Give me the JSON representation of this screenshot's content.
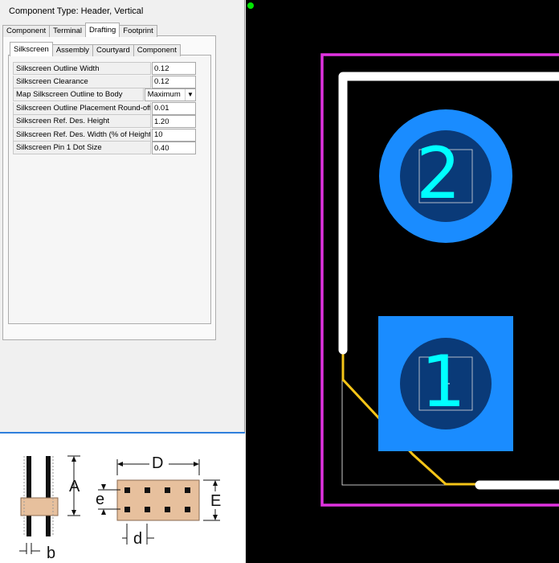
{
  "component_type": "Component Type: Header, Vertical",
  "main_tabs": [
    {
      "label": "Component",
      "active": false
    },
    {
      "label": "Terminal",
      "active": false
    },
    {
      "label": "Drafting",
      "active": true
    },
    {
      "label": "Footprint",
      "active": false
    }
  ],
  "sub_tabs": [
    {
      "label": "Silkscreen",
      "active": true
    },
    {
      "label": "Assembly",
      "active": false
    },
    {
      "label": "Courtyard",
      "active": false
    },
    {
      "label": "Component",
      "active": false
    }
  ],
  "properties": [
    {
      "label": "Silkscreen Outline Width",
      "value": "0.12"
    },
    {
      "label": "Silkscreen Clearance",
      "value": "0.12"
    },
    {
      "label": "Map Silkscreen Outline to Body",
      "value": "Maximum"
    },
    {
      "label": "Silkscreen Outline Placement Round-off",
      "value": "0.01"
    },
    {
      "label": "Silkscreen Ref. Des. Height",
      "value": "1.20"
    },
    {
      "label": "Silkscreen Ref. Des. Width (% of Height)",
      "value": "10"
    },
    {
      "label": "Silkscreen Pin 1 Dot Size",
      "value": "0.40"
    }
  ],
  "diagram_labels": {
    "A": "A",
    "b": "b",
    "D": "D",
    "e": "e",
    "E": "E",
    "d": "d"
  },
  "pads": {
    "pad1": "1",
    "pad2": "2"
  },
  "colors": {
    "courtyard": "#e033e0",
    "silkscreen": "#ffffff",
    "assembly": "#f5c518",
    "pad_outer": "#1a8cff",
    "pad_inner": "#0a3a78",
    "pad_label": "#00ffff",
    "tab_border": "#2f7fdc"
  }
}
